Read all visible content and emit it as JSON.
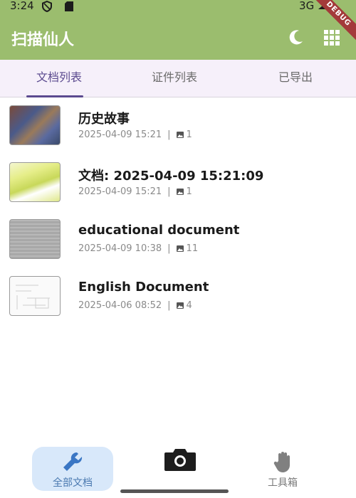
{
  "status_bar": {
    "time": "3:24",
    "network": "3G"
  },
  "debug_banner": "DEBUG",
  "app_bar": {
    "title": "扫描仙人",
    "icons": [
      "moon-icon",
      "grid-icon"
    ]
  },
  "tabs": [
    {
      "label": "文档列表",
      "active": true
    },
    {
      "label": "证件列表",
      "active": false
    },
    {
      "label": "已导出",
      "active": false
    }
  ],
  "documents": [
    {
      "title": "历史故事",
      "date": "2025-04-09 15:21",
      "pages": "1"
    },
    {
      "title": "文档: 2025-04-09 15:21:09",
      "date": "2025-04-09 15:21",
      "pages": "1"
    },
    {
      "title": "educational document",
      "date": "2025-04-09 10:38",
      "pages": "11"
    },
    {
      "title": "English Document",
      "date": "2025-04-06 08:52",
      "pages": "4"
    }
  ],
  "meta_separator": "|",
  "bottom_nav": {
    "all_docs": "全部文档",
    "camera": "camera-icon",
    "tools": "工具箱"
  },
  "colors": {
    "app_bar": "#9bbd6e",
    "accent": "#5b4a8f",
    "nav_selected": "#d8e8fa"
  }
}
